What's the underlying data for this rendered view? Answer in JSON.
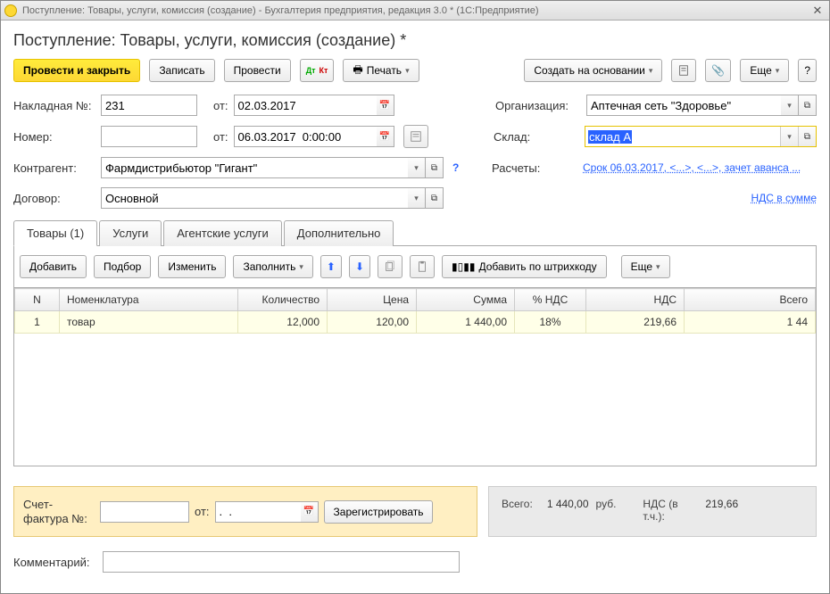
{
  "window": {
    "title": "Поступление: Товары, услуги, комиссия (создание) - Бухгалтерия предприятия, редакция 3.0 *  (1С:Предприятие)"
  },
  "page": {
    "heading": "Поступление: Товары, услуги, комиссия (создание) *"
  },
  "toolbar": {
    "post_close": "Провести и закрыть",
    "save": "Записать",
    "post": "Провести",
    "print": "Печать",
    "create_based": "Создать на основании",
    "more": "Еще",
    "help": "?"
  },
  "labels": {
    "invoice_no": "Накладная  №:",
    "from": "от:",
    "number": "Номер:",
    "counterparty": "Контрагент:",
    "contract": "Договор:",
    "organization": "Организация:",
    "warehouse": "Склад:",
    "settlements": "Расчеты:",
    "vat_in_sum": "НДС в сумме",
    "invoice_fact": "Счет-фактура №:",
    "register": "Зарегистрировать",
    "total": "Всего:",
    "rub": "руб.",
    "vat_incl": "НДС (в т.ч.):",
    "comment": "Комментарий:"
  },
  "fields": {
    "invoice_no": "231",
    "invoice_date": "02.03.2017",
    "number": "",
    "doc_date": "06.03.2017  0:00:00",
    "counterparty": "Фармдистрибьютор \"Гигант\"",
    "contract": "Основной",
    "organization": "Аптечная сеть \"Здоровье\"",
    "warehouse": "склад А",
    "settlements_link": "Срок 06.03.2017, <...>, <...>, зачет аванса ...",
    "invoice_fact_no": "",
    "invoice_fact_date": ".  .",
    "comment": ""
  },
  "tabs": {
    "goods": "Товары (1)",
    "services": "Услуги",
    "agency": "Агентские услуги",
    "extra": "Дополнительно"
  },
  "subtoolbar": {
    "add": "Добавить",
    "pick": "Подбор",
    "edit": "Изменить",
    "fill": "Заполнить",
    "add_barcode": "Добавить по штрихкоду",
    "more": "Еще"
  },
  "table": {
    "headers": {
      "n": "N",
      "nomenclature": "Номенклатура",
      "qty": "Количество",
      "price": "Цена",
      "sum": "Сумма",
      "vat_pct": "% НДС",
      "vat": "НДС",
      "total": "Всего"
    },
    "rows": [
      {
        "n": "1",
        "nomenclature": "товар",
        "qty": "12,000",
        "price": "120,00",
        "sum": "1 440,00",
        "vat_pct": "18%",
        "vat": "219,66",
        "total": "1 44"
      }
    ]
  },
  "totals": {
    "sum": "1 440,00",
    "vat": "219,66"
  }
}
